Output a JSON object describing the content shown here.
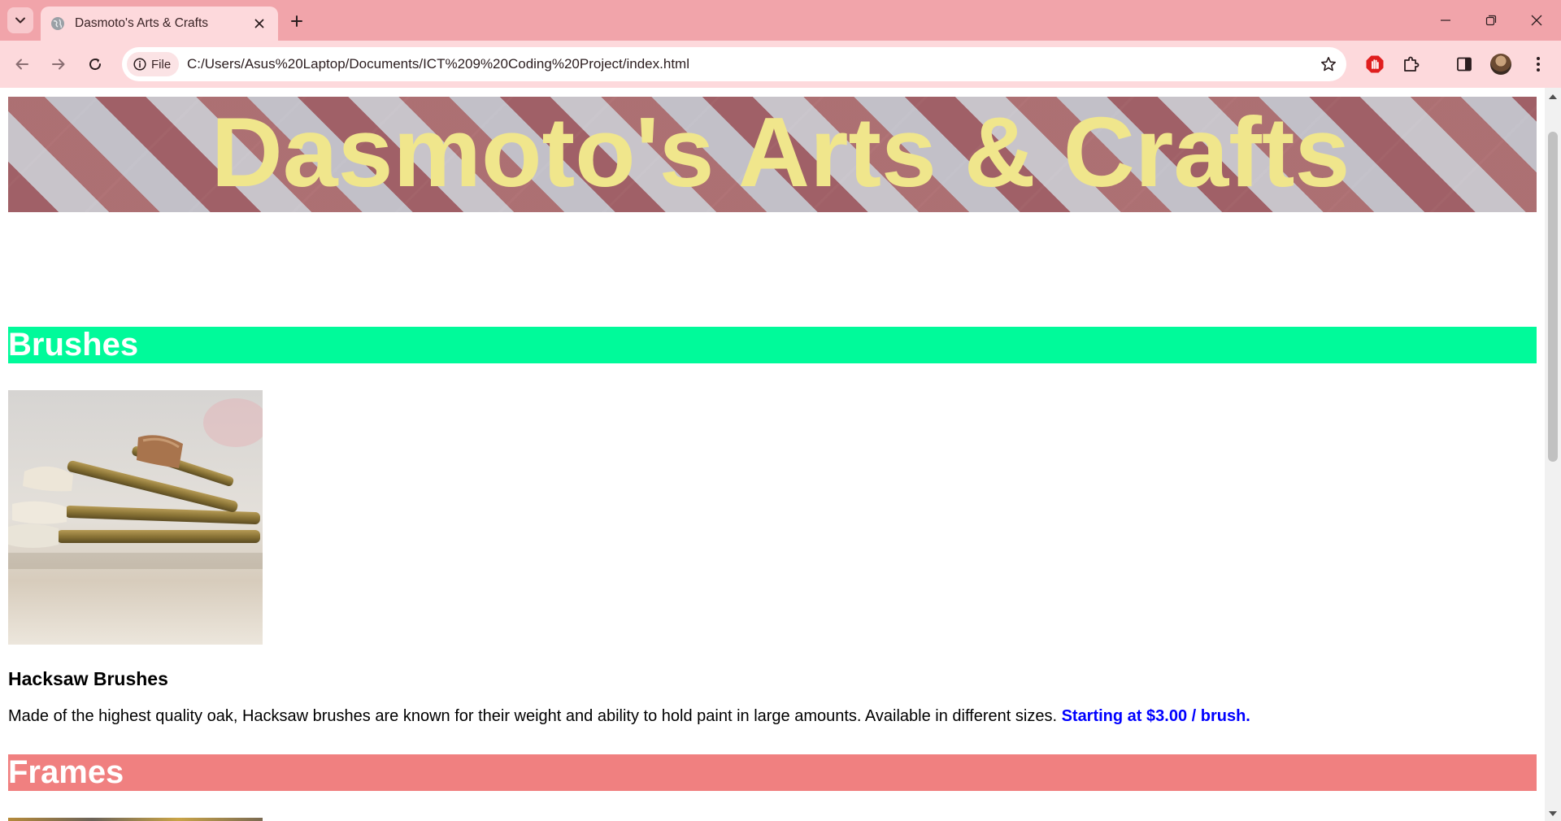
{
  "browser": {
    "tab": {
      "title": "Dasmoto's Arts & Crafts"
    },
    "address_bar": {
      "site_chip_label": "File",
      "url": "C:/Users/Asus%20Laptop/Documents/ICT%209%20Coding%20Project/index.html"
    },
    "icons": {
      "tab_search": "chevron-down-icon",
      "favicon": "globe-icon",
      "tab_close": "close-icon",
      "new_tab": "plus-icon",
      "minimize": "minimize-icon",
      "restore": "restore-icon",
      "close_window": "close-icon",
      "back": "back-arrow-icon",
      "forward": "forward-arrow-icon",
      "reload": "reload-icon",
      "site_info": "info-icon",
      "bookmark": "star-icon",
      "adblock": "stop-hand-icon",
      "extensions": "puzzle-icon",
      "side_panel": "side-panel-icon",
      "profile": "avatar",
      "menu": "kebab-menu-icon"
    }
  },
  "page": {
    "banner_title": "Dasmoto's Arts & Crafts",
    "sections": [
      {
        "heading": "Brushes",
        "heading_color": "#00fa9a",
        "product": {
          "title": "Hacksaw Brushes",
          "description": "Made of the highest quality oak, Hacksaw brushes are known for their weight and ability to hold paint in large amounts. Available in different sizes. ",
          "price": "Starting at $3.00 / brush."
        }
      },
      {
        "heading": "Frames",
        "heading_color": "#f08080"
      }
    ],
    "colors": {
      "banner_text": "#f0e68c",
      "price_text": "#0000ff",
      "chrome_tabstrip": "#f1a4aa",
      "chrome_toolbar": "#fdd9dc"
    }
  }
}
